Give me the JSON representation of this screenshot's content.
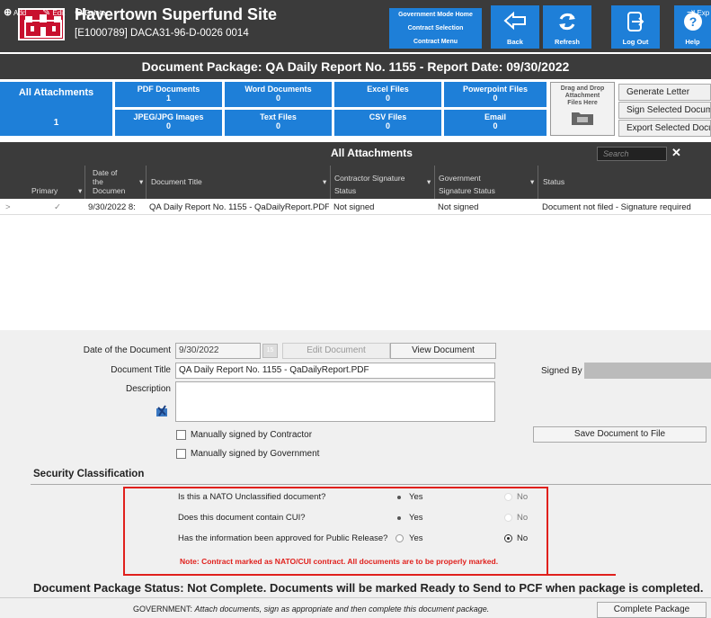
{
  "header": {
    "site_title": "Havertown Superfund Site",
    "contract_id": "[E1000789] DACA31-96-D-0026 0014",
    "nav": {
      "gov_home": "Government Mode Home",
      "contract_selection": "Contract Selection",
      "contract_menu": "Contract Menu"
    },
    "buttons": {
      "back": "Back",
      "refresh": "Refresh",
      "logout": "Log Out",
      "help": "Help"
    }
  },
  "package_title": "Document Package: QA Daily Report No. 1155 - Report Date: 09/30/2022",
  "tiles": {
    "all_attachments": {
      "label": "All Attachments",
      "count": "1"
    },
    "pdf": {
      "label": "PDF Documents",
      "count": "1"
    },
    "word": {
      "label": "Word Documents",
      "count": "0"
    },
    "excel": {
      "label": "Excel Files",
      "count": "0"
    },
    "powerpoint": {
      "label": "Powerpoint Files",
      "count": "0"
    },
    "jpeg": {
      "label": "JPEG/JPG Images",
      "count": "0"
    },
    "text": {
      "label": "Text Files",
      "count": "0"
    },
    "csv": {
      "label": "CSV Files",
      "count": "0"
    },
    "email": {
      "label": "Email",
      "count": "0"
    }
  },
  "drag_drop": "Drag and Drop Attachment Files Here",
  "actions": {
    "generate_letter": "Generate Letter",
    "sign_selected": "Sign Selected Docume",
    "export_selected": "Export Selected Docum"
  },
  "toolbar": {
    "add": "Add",
    "edit": "Edit",
    "delete": "Delete",
    "title": "All Attachments",
    "search_placeholder": "Search",
    "export": "Exp"
  },
  "grid": {
    "headers": {
      "primary": "Primary",
      "date_l1": "Date of",
      "date_l2": "the",
      "date_l3": "Documen",
      "doc_title": "Document Title",
      "contractor_l1": "Contractor Signature",
      "contractor_l2": "Status",
      "gov_l1": "Government",
      "gov_l2": "Signature Status",
      "status": "Status"
    },
    "rows": [
      {
        "primary": "✓",
        "date": "9/30/2022 8:",
        "title": "QA Daily Report No. 1155 - QaDailyReport.PDF",
        "contractor": "Not signed",
        "government": "Not signed",
        "status": "Document not filed - Signature required"
      }
    ]
  },
  "form": {
    "date_label": "Date of the Document",
    "date_value": "9/30/2022",
    "cal_label": "15",
    "edit_document": "Edit Document",
    "view_document": "View Document",
    "title_label": "Document Title",
    "title_value": "QA Daily Report No. 1155 - QaDailyReport.PDF",
    "signed_by_label": "Signed By",
    "description_label": "Description",
    "manual_contractor": "Manually signed by Contractor",
    "manual_government": "Manually signed by Government",
    "save_to_file": "Save Document to File"
  },
  "security": {
    "heading": "Security Classification",
    "questions": [
      {
        "q": "Is this a NATO Unclassified document?",
        "yes": "Yes",
        "no": "No"
      },
      {
        "q": "Does this document contain CUI?",
        "yes": "Yes",
        "no": "No"
      },
      {
        "q": "Has the information been approved for Public Release?",
        "yes": "Yes",
        "no": "No"
      }
    ],
    "note": "Note: Contract marked as NATO/CUI contract. All documents are to be properly marked."
  },
  "package_status": {
    "text": "Document Package Status: Not Complete. Documents will be marked Ready to Send to PCF when package is completed.",
    "gov_label": "GOVERNMENT:",
    "gov_instruction": "Attach documents, sign as appropriate and then complete this document package.",
    "complete_button": "Complete Package"
  },
  "colors": {
    "accent": "#1e7fd8",
    "header_bg": "#3b3b3b",
    "alert": "#e0201c",
    "brand": "#c8102e"
  }
}
